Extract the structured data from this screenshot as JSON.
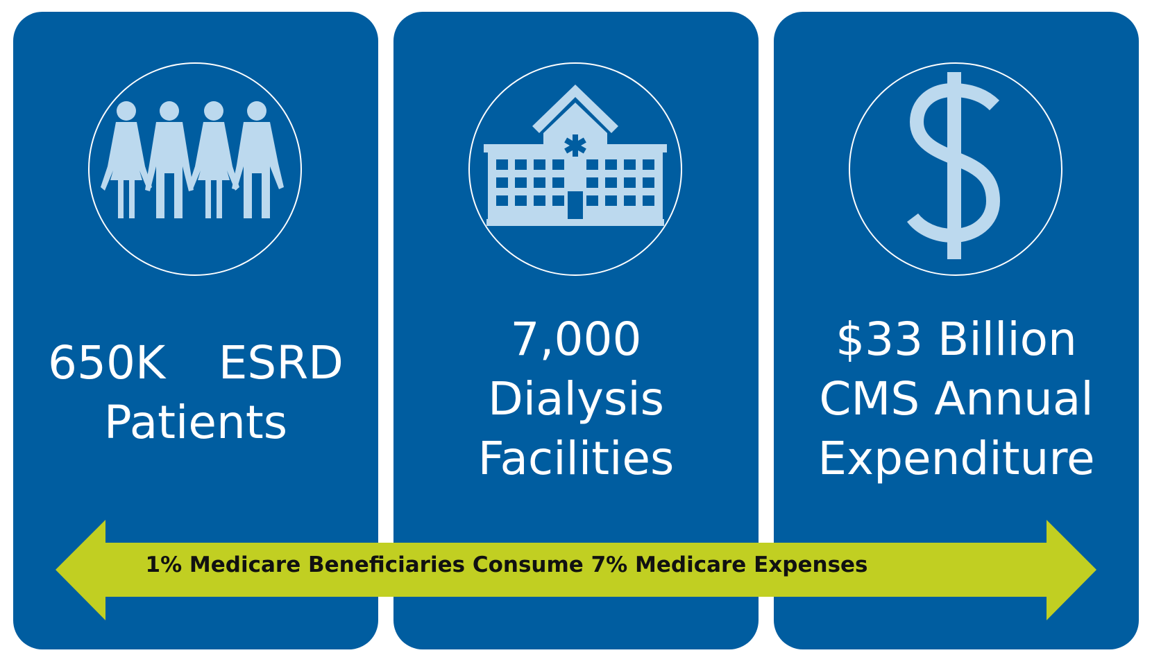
{
  "colors": {
    "panel": "#005da0",
    "icon": "#bcd9ee",
    "arrow": "#c1cf22",
    "text": "#ffffff"
  },
  "panels": [
    {
      "icon": "people-icon",
      "line1a": "650K",
      "line1b": "ESRD",
      "line2": "Patients"
    },
    {
      "icon": "hospital-icon",
      "line1": "7,000",
      "line2": "Dialysis",
      "line3": "Facilities"
    },
    {
      "icon": "dollar-icon",
      "line1": "$33 Billion",
      "line2": "CMS Annual",
      "line3": "Expenditure"
    }
  ],
  "arrow": {
    "icon": "double-arrow-icon",
    "text": "1% Medicare Beneficiaries Consume 7% Medicare Expenses"
  }
}
